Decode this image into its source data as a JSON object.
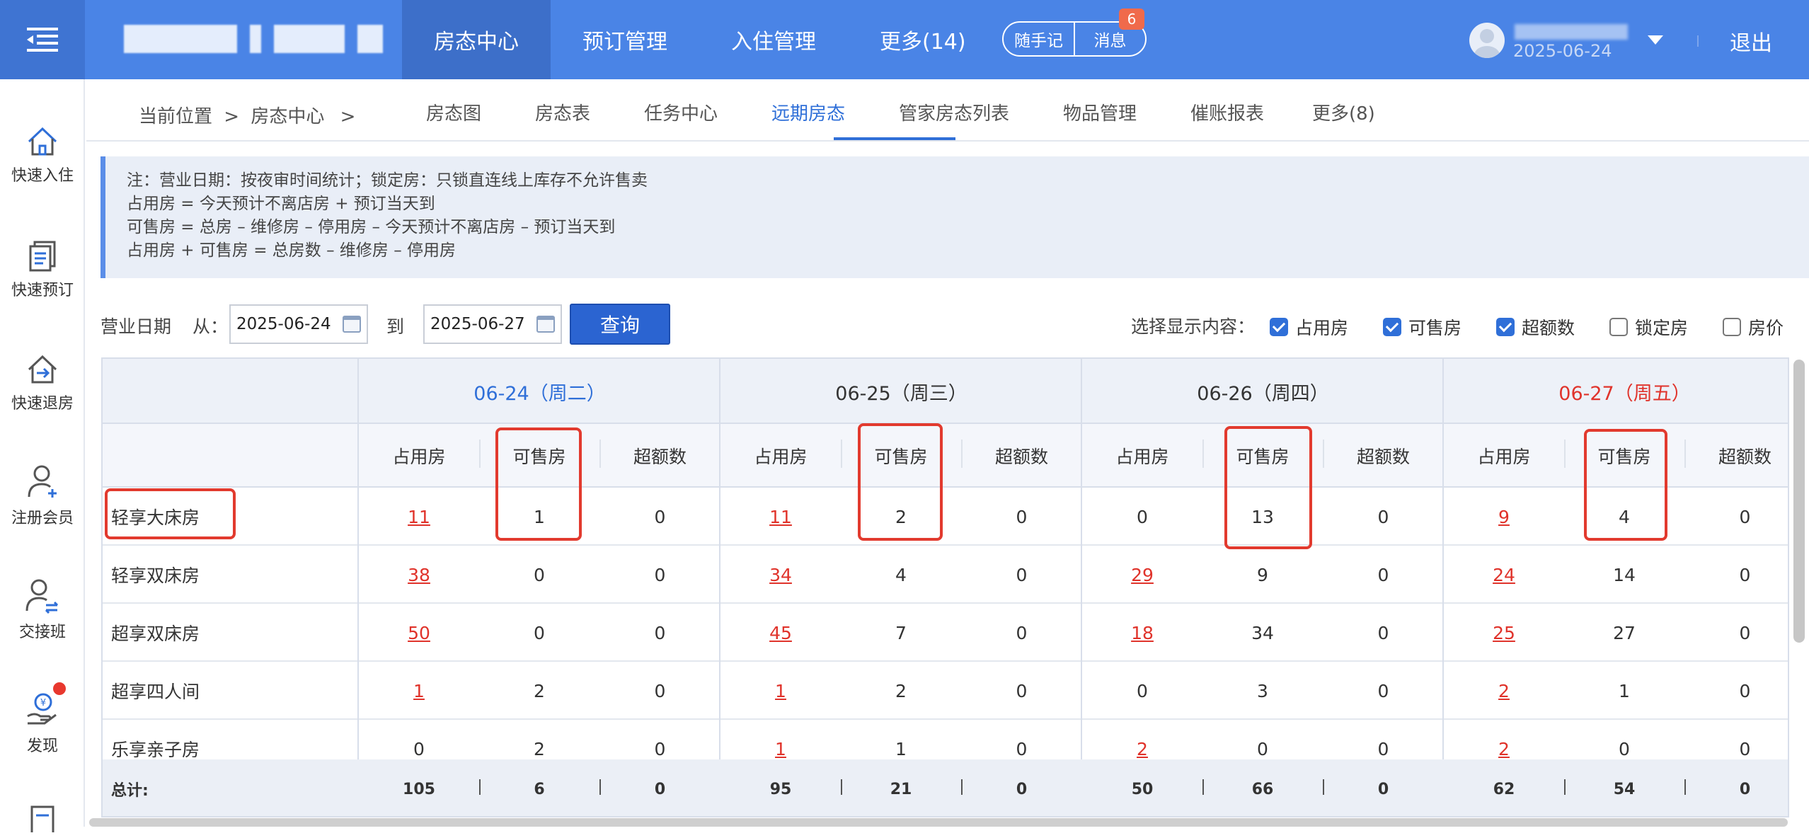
{
  "topbar": {
    "nav": [
      "房态中心",
      "预订管理",
      "入住管理",
      "更多(14)"
    ],
    "active_nav": "房态中心",
    "notes_btn": "随手记",
    "msg_btn": "消息",
    "msg_badge": "6",
    "user_date": "2025-06-24",
    "logout": "退出"
  },
  "sidebar": {
    "items": [
      "快速入住",
      "快速预订",
      "快速退房",
      "注册会员",
      "交接班",
      "发现"
    ]
  },
  "breadcrumb": {
    "label": "当前位置",
    "sep1": ">",
    "current": "房态中心",
    "sep2": ">"
  },
  "tabs": [
    "房态图",
    "房态表",
    "任务中心",
    "远期房态",
    "管家房态列表",
    "物品管理",
    "催账报表",
    "更多(8)"
  ],
  "active_tab": "远期房态",
  "notes": [
    "注：营业日期：按夜审时间统计；锁定房：只锁直连线上库存不允许售卖",
    "占用房 = 今天预计不离店房 + 预订当天到",
    "可售房 = 总房 – 维修房 – 停用房 – 今天预计不离店房 – 预订当天到",
    "占用房 + 可售房 = 总房数 – 维修房 – 停用房"
  ],
  "filter": {
    "label": "营业日期",
    "from_label": "从：",
    "from_date": "2025-06-24",
    "to_label": "到",
    "to_date": "2025-06-27",
    "query_btn": "查询",
    "display_label": "选择显示内容：",
    "options": [
      {
        "label": "占用房",
        "checked": true
      },
      {
        "label": "可售房",
        "checked": true
      },
      {
        "label": "超额数",
        "checked": true
      },
      {
        "label": "锁定房",
        "checked": false
      },
      {
        "label": "房价",
        "checked": false
      }
    ]
  },
  "table": {
    "days": [
      {
        "label": "06-24（周二）",
        "color": "#2f6fd8"
      },
      {
        "label": "06-25（周三）",
        "color": "#333333"
      },
      {
        "label": "06-26（周四）",
        "color": "#333333"
      },
      {
        "label": "06-27（周五）",
        "color": "#e0332b"
      }
    ],
    "subcols": [
      "占用房",
      "可售房",
      "超额数"
    ],
    "rows": [
      {
        "name": "轻享大床房",
        "values": [
          "11",
          "1",
          "0",
          "11",
          "2",
          "0",
          "0",
          "13",
          "0",
          "9",
          "4",
          "0"
        ]
      },
      {
        "name": "轻享双床房",
        "values": [
          "38",
          "0",
          "0",
          "34",
          "4",
          "0",
          "29",
          "9",
          "0",
          "24",
          "14",
          "0"
        ]
      },
      {
        "name": "超享双床房",
        "values": [
          "50",
          "0",
          "0",
          "45",
          "7",
          "0",
          "18",
          "34",
          "0",
          "25",
          "27",
          "0"
        ]
      },
      {
        "name": "超享四人间",
        "values": [
          "1",
          "2",
          "0",
          "1",
          "2",
          "0",
          "0",
          "3",
          "0",
          "2",
          "1",
          "0"
        ]
      },
      {
        "name": "乐享亲子房",
        "values": [
          "0",
          "2",
          "0",
          "1",
          "1",
          "0",
          "2",
          "0",
          "0",
          "2",
          "0",
          "0"
        ]
      }
    ],
    "total_label": "总计:",
    "totals": [
      "105",
      "6",
      "0",
      "95",
      "21",
      "0",
      "50",
      "66",
      "0",
      "62",
      "54",
      "0"
    ]
  }
}
